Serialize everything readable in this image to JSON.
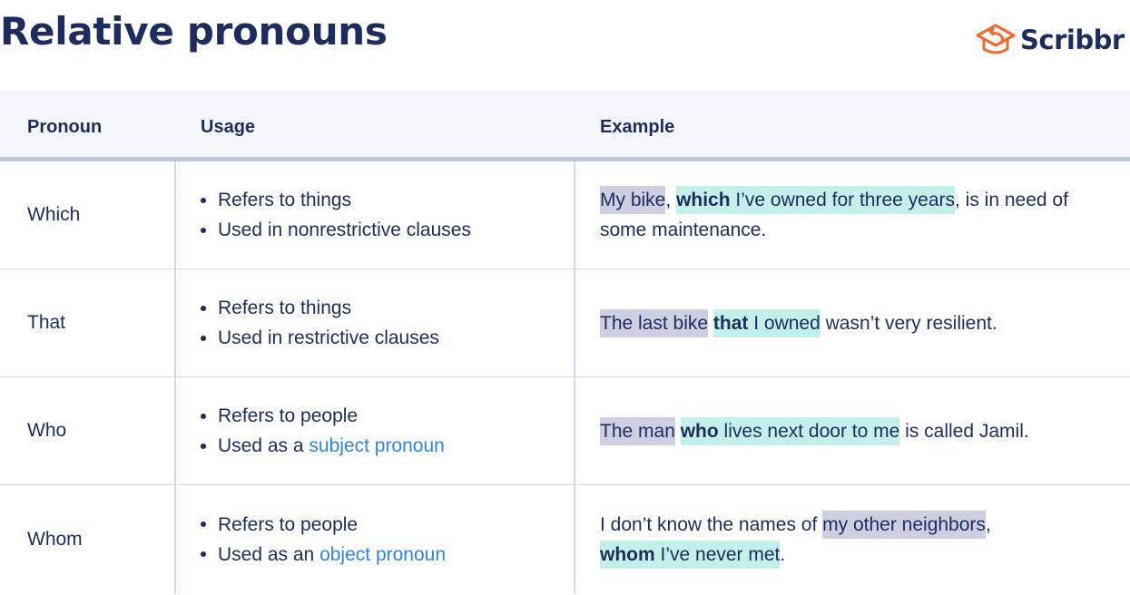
{
  "title": "Relative pronouns",
  "logo": {
    "text": "Scribbr",
    "icon": "graduation-cap-icon",
    "icon_color": "#f0692b"
  },
  "colors": {
    "text": "#1d2b5e",
    "link": "#2b84e6",
    "antecedent_highlight": "#cfcfe4",
    "clause_highlight": "#c3f0ea",
    "header_bg": "#f6f7fc"
  },
  "table": {
    "headers": [
      "Pronoun",
      "Usage",
      "Example"
    ],
    "rows": [
      {
        "pronoun": "Which",
        "usage": [
          {
            "text": "Refers to things"
          },
          {
            "text": "Used in nonrestrictive clauses"
          }
        ],
        "example": {
          "antecedent": "My bike",
          "sep1": ", ",
          "pronoun": "which",
          "clause_rest": " I’ve owned for three years",
          "after": ", is in need of some maintenance."
        }
      },
      {
        "pronoun": "That",
        "usage": [
          {
            "text": "Refers to things"
          },
          {
            "text": "Used in restrictive clauses"
          }
        ],
        "example": {
          "antecedent": "The last bike",
          "sep1": " ",
          "pronoun": "that",
          "clause_rest": " I owned",
          "after": " wasn’t very resilient."
        }
      },
      {
        "pronoun": "Who",
        "usage": [
          {
            "text": "Refers to people"
          },
          {
            "prefix": "Used as a ",
            "link": "subject pronoun"
          }
        ],
        "example": {
          "antecedent": "The man",
          "sep1": " ",
          "pronoun": "who",
          "clause_rest": " lives next door to me",
          "after": " is called Jamil."
        }
      },
      {
        "pronoun": "Whom",
        "usage": [
          {
            "text": "Refers to people"
          },
          {
            "prefix": "Used as an ",
            "link": "object pronoun"
          }
        ],
        "example": {
          "before": "I don’t know the names of ",
          "antecedent": "my other neighbors",
          "sep1": ", ",
          "pronoun": "whom",
          "clause_rest": " I’ve never met",
          "after": "."
        }
      }
    ]
  }
}
